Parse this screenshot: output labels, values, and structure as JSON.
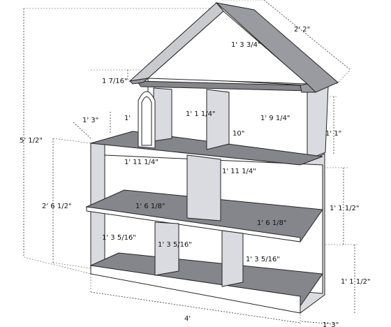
{
  "dimensions": {
    "roof_depth": "2' 2\"",
    "roof_height": "1' 3 3/4\"",
    "roof_overhang": "1 7/16\"",
    "total_height": "5' 1/2\"",
    "mid_height": "2' 6 1/2\"",
    "attic_door": "1' 3\"",
    "attic_door_small": "1'",
    "attic_left_width": "1' 1 1/4\"",
    "attic_right_width": "1' 9 1/4\"",
    "attic_divider": "10\"",
    "top_right_height": "1' 1\"",
    "mid_left_width": "1' 11 1/4\"",
    "mid_right_width": "1' 11 1/4\"",
    "mid_right_height": "1' 1 1/2\"",
    "shelf_left_depth": "1' 6 1/8\"",
    "shelf_right_depth": "1' 6 1/8\"",
    "bottom_left_width": "1' 3 5/16\"",
    "bottom_mid_width": "1' 3 5/16\"",
    "bottom_right_width": "1' 3 5/16\"",
    "bottom_right_height": "1' 1 1/2\"",
    "total_width": "4'",
    "base_depth": "1' 3\""
  }
}
